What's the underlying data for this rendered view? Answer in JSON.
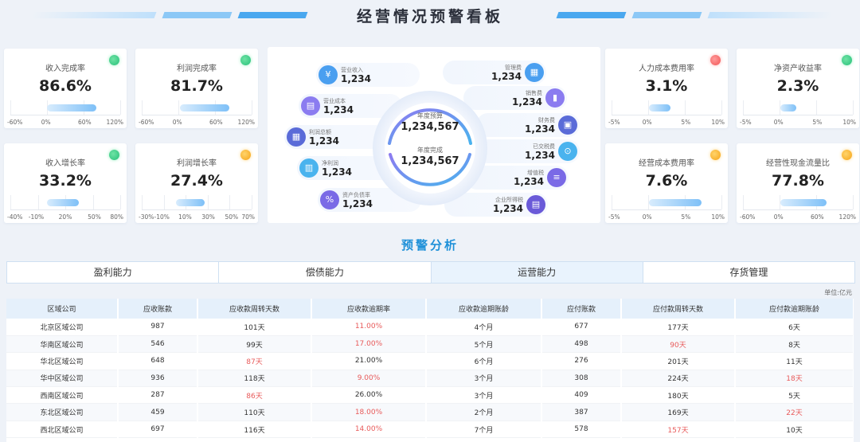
{
  "header": {
    "title": "经营情况预警看板"
  },
  "kpis": [
    {
      "label": "收入完成率",
      "value": "86.6%",
      "status": "green",
      "ticks": [
        "-60%",
        "0%",
        "60%",
        "120%"
      ]
    },
    {
      "label": "利润完成率",
      "value": "81.7%",
      "status": "green",
      "ticks": [
        "-60%",
        "0%",
        "60%",
        "120%"
      ]
    },
    {
      "label": "收入增长率",
      "value": "33.2%",
      "status": "green",
      "ticks": [
        "-40%",
        "-10%",
        "20%",
        "50%",
        "80%"
      ]
    },
    {
      "label": "利润增长率",
      "value": "27.4%",
      "status": "orange",
      "ticks": [
        "-30%",
        "-10%",
        "10%",
        "30%",
        "50%",
        "70%"
      ]
    },
    {
      "label": "人力成本费用率",
      "value": "3.1%",
      "status": "red",
      "ticks": [
        "-5%",
        "0%",
        "5%",
        "10%"
      ]
    },
    {
      "label": "净资产收益率",
      "value": "2.3%",
      "status": "green",
      "ticks": [
        "-5%",
        "0%",
        "5%",
        "10%"
      ]
    },
    {
      "label": "经营成本费用率",
      "value": "7.6%",
      "status": "orange",
      "ticks": [
        "-5%",
        "0%",
        "5%",
        "10%"
      ]
    },
    {
      "label": "经营性现金流量比",
      "value": "77.8%",
      "status": "orange",
      "ticks": [
        "-60%",
        "0%",
        "60%",
        "120%"
      ]
    }
  ],
  "center": {
    "budget_label": "年度预算",
    "budget_value": "1,234,567",
    "actual_label": "年度完成",
    "actual_value": "1,234,567",
    "left_items": [
      {
        "label": "营业收入",
        "value": "1,234",
        "icon": "money-bag-icon"
      },
      {
        "label": "营业成本",
        "value": "1,234",
        "icon": "cost-icon"
      },
      {
        "label": "利润总额",
        "value": "1,234",
        "icon": "document-icon"
      },
      {
        "label": "净利润",
        "value": "1,234",
        "icon": "chart-card-icon"
      },
      {
        "label": "资产负债率",
        "value": "1,234",
        "icon": "ratio-icon"
      }
    ],
    "right_items": [
      {
        "label": "管理费",
        "value": "1,234",
        "icon": "calendar-icon"
      },
      {
        "label": "销售费",
        "value": "1,234",
        "icon": "bar-chart-icon"
      },
      {
        "label": "财务费",
        "value": "1,234",
        "icon": "wallet-icon"
      },
      {
        "label": "已交税费",
        "value": "1,234",
        "icon": "tax-icon"
      },
      {
        "label": "增值税",
        "value": "1,234",
        "icon": "layers-icon"
      },
      {
        "label": "企业所得税",
        "value": "1,234",
        "icon": "receipt-icon"
      }
    ]
  },
  "section": {
    "title": "预警分析"
  },
  "tabs": [
    "盈利能力",
    "偿债能力",
    "运营能力",
    "存货管理"
  ],
  "active_tab": "运营能力",
  "unit": "单位:亿元",
  "table": {
    "headers": [
      "区域公司",
      "应收账款",
      "应收款周转天数",
      "应收款逾期率",
      "应收款逾期账龄",
      "应付账款",
      "应付款周转天数",
      "应付款逾期账龄"
    ],
    "rows": [
      [
        "北京区域公司",
        "987",
        "101天",
        "11.00%",
        "4个月",
        "677",
        "177天",
        "6天"
      ],
      [
        "华南区域公司",
        "546",
        "99天",
        "17.00%",
        "5个月",
        "498",
        "90天",
        "8天"
      ],
      [
        "华北区域公司",
        "648",
        "87天",
        "21.00%",
        "6个月",
        "276",
        "201天",
        "11天"
      ],
      [
        "华中区域公司",
        "936",
        "118天",
        "9.00%",
        "3个月",
        "308",
        "224天",
        "18天"
      ],
      [
        "西南区域公司",
        "287",
        "86天",
        "26.00%",
        "3个月",
        "409",
        "180天",
        "5天"
      ],
      [
        "东北区域公司",
        "459",
        "110天",
        "18.00%",
        "2个月",
        "387",
        "169天",
        "22天"
      ],
      [
        "西北区域公司",
        "697",
        "116天",
        "14.00%",
        "7个月",
        "578",
        "157天",
        "10天"
      ]
    ],
    "warn_cells": [
      [
        0,
        3
      ],
      [
        1,
        3
      ],
      [
        1,
        6
      ],
      [
        2,
        2
      ],
      [
        3,
        3
      ],
      [
        3,
        7
      ],
      [
        4,
        2
      ],
      [
        5,
        3
      ],
      [
        5,
        7
      ],
      [
        6,
        3
      ],
      [
        6,
        6
      ]
    ]
  },
  "colors": {
    "accent": "#1e90d8",
    "warn": "#e85a5a"
  }
}
